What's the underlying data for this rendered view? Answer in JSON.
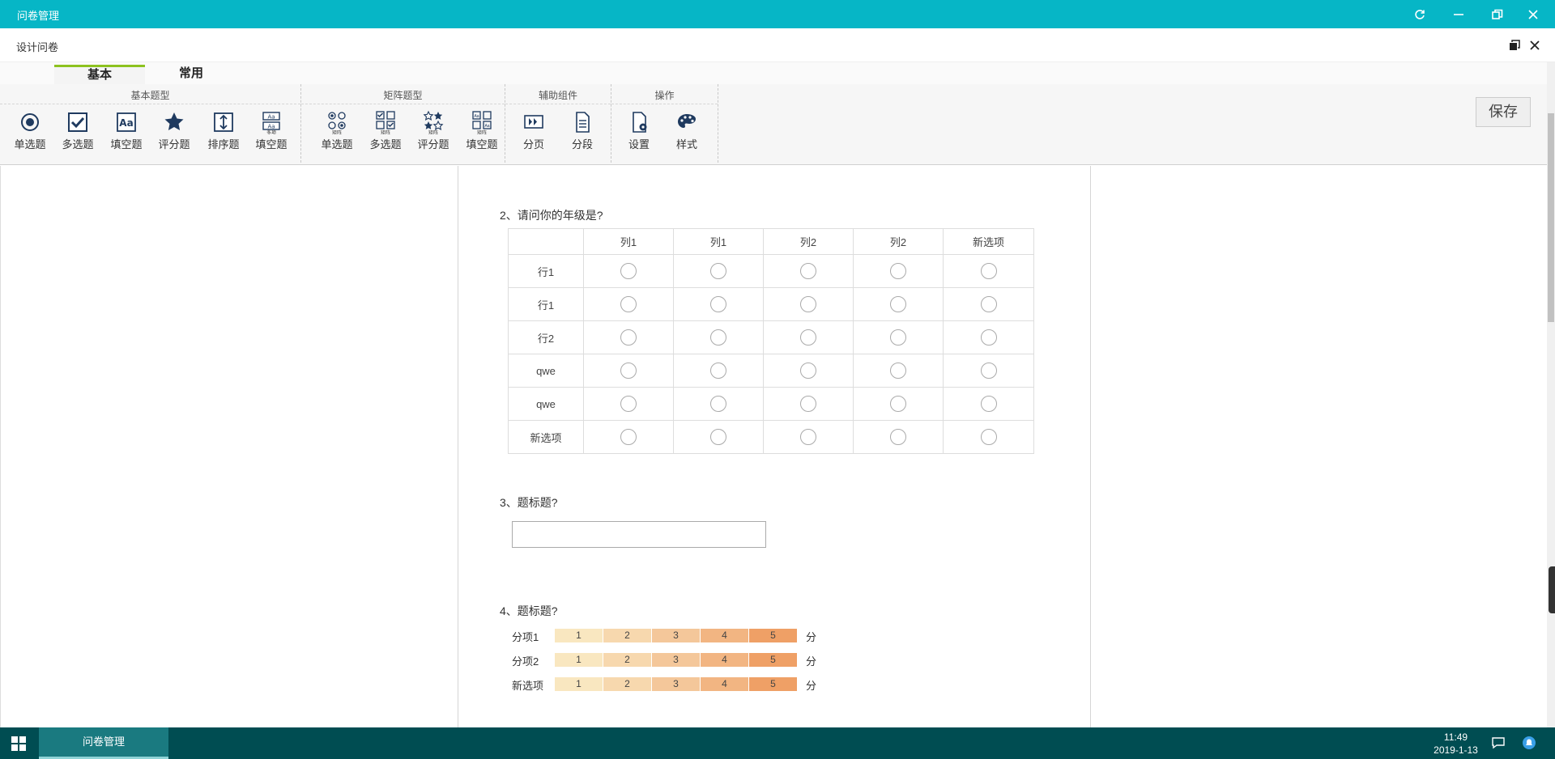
{
  "window": {
    "title": "问卷管理",
    "controls": [
      "refresh-icon",
      "minimize-icon",
      "restore-icon",
      "close-icon"
    ]
  },
  "subheader": {
    "title": "设计问卷"
  },
  "ribbon": {
    "tabs": [
      {
        "label": "基本",
        "active": true
      },
      {
        "label": "常用",
        "active": false
      }
    ],
    "groups": [
      {
        "title": "基本题型",
        "buttons": [
          {
            "label": "单选题",
            "icon": "radio-icon"
          },
          {
            "label": "多选题",
            "icon": "checkbox-icon"
          },
          {
            "label": "填空题",
            "icon": "text-field-icon"
          },
          {
            "label": "评分题",
            "icon": "star-icon"
          },
          {
            "label": "排序题",
            "icon": "sort-icon"
          },
          {
            "label": "填空题",
            "icon": "multi-text-field-icon",
            "badge": "多项"
          }
        ]
      },
      {
        "title": "矩阵题型",
        "buttons": [
          {
            "label": "单选题",
            "icon": "matrix-radio-icon",
            "badge": "矩阵"
          },
          {
            "label": "多选题",
            "icon": "matrix-checkbox-icon",
            "badge": "矩阵"
          },
          {
            "label": "评分题",
            "icon": "matrix-star-icon",
            "badge": "矩阵"
          },
          {
            "label": "填空题",
            "icon": "matrix-text-field-icon",
            "badge": "矩阵"
          }
        ]
      },
      {
        "title": "辅助组件",
        "buttons": [
          {
            "label": "分页",
            "icon": "page-break-icon"
          },
          {
            "label": "分段",
            "icon": "section-icon"
          }
        ]
      },
      {
        "title": "操作",
        "buttons": [
          {
            "label": "设置",
            "icon": "settings-icon"
          },
          {
            "label": "样式",
            "icon": "palette-icon"
          }
        ]
      }
    ],
    "save_label": "保存"
  },
  "questions": {
    "q2": {
      "title": "2、请问你的年级是?",
      "columns": [
        "列1",
        "列1",
        "列2",
        "列2",
        "新选项"
      ],
      "rows": [
        "行1",
        "行1",
        "行2",
        "qwe",
        "qwe",
        "新选项"
      ]
    },
    "q3": {
      "title": "3、题标题?",
      "input_value": ""
    },
    "q4": {
      "title": "4、题标题?",
      "scale": [
        "1",
        "2",
        "3",
        "4",
        "5"
      ],
      "scale_colors": [
        "#f9e7c0",
        "#f7d8ae",
        "#f4c79a",
        "#f2b582",
        "#efa066"
      ],
      "unit": "分",
      "items": [
        "分项1",
        "分项2",
        "新选项"
      ]
    }
  },
  "taskbar": {
    "app_label": "问卷管理",
    "time": "11:49",
    "date": "2019-1-13"
  }
}
